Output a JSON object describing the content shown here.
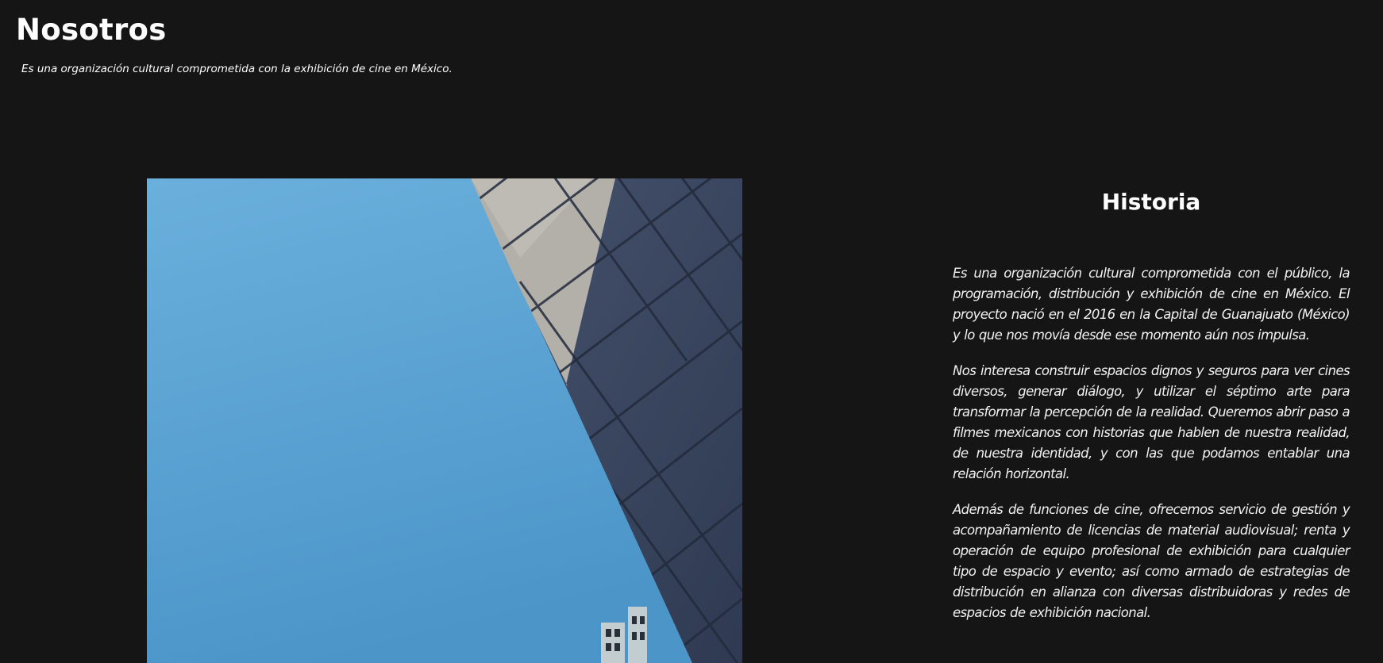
{
  "header": {
    "title": "Nosotros",
    "subtitle": "Es una organización cultural comprometida con la exhibición de cine en México."
  },
  "hero_image": {
    "description": "architecture-photo",
    "colors": {
      "sky": "#5ea6d6",
      "facade": "#3b4761",
      "sunlit_concrete": "#b9b6b0"
    }
  },
  "history": {
    "title": "Historia",
    "paragraphs": [
      "Es una organización cultural comprometida con el público, la programación, distribución y exhibición de cine en México. El proyecto nació en el 2016 en la Capital de Guanajuato (México) y lo que nos movía desde ese momento aún nos impulsa.",
      "Nos interesa construir espacios dignos y seguros para ver cines diversos, generar diálogo, y utilizar el séptimo arte para transformar la percepción de la realidad. Queremos abrir paso a filmes mexicanos con historias que hablen de nuestra realidad, de nuestra identidad, y con las que podamos entablar una relación horizontal.",
      "Además de funciones de cine, ofrecemos servicio de gestión y acompañamiento de licencias de material audiovisual; renta y operación de equipo profesional de exhibición para cualquier tipo de espacio y evento; así como armado de estrategias de distribución en alianza con diversas distribuidoras y redes de espacios de exhibición nacional."
    ]
  },
  "colors": {
    "background": "#151515",
    "text": "#ffffff"
  }
}
